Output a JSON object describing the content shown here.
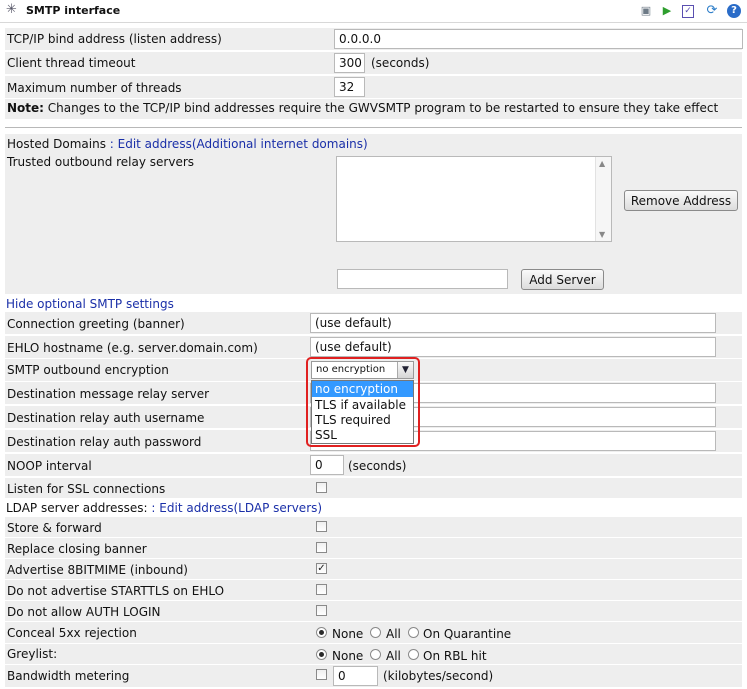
{
  "header": {
    "title": "SMTP interface"
  },
  "bind": {
    "label": "TCP/IP bind address (listen address)",
    "value": "0.0.0.0"
  },
  "client_timeout": {
    "label": "Client thread timeout",
    "value": "300",
    "unit": "(seconds)"
  },
  "max_threads": {
    "label": "Maximum number of threads",
    "value": "32"
  },
  "note": {
    "bold": "Note:",
    "text": " Changes to the TCP/IP bind addresses require the GWVSMTP program to be restarted to ensure they take effect"
  },
  "hosted_domains": {
    "label": "Hosted Domains",
    "sep": " : ",
    "link": "Edit address(Additional internet domains)"
  },
  "relay_servers": {
    "label": "Trusted outbound relay servers",
    "remove_button": "Remove Address",
    "add_button": "Add Server",
    "new_value": ""
  },
  "optional_link": "Hide optional SMTP settings",
  "greeting": {
    "label": "Connection greeting (banner)",
    "value": "(use default)"
  },
  "ehlo": {
    "label": "EHLO hostname (e.g. server.domain.com)",
    "value": "(use default)"
  },
  "encryption": {
    "label": "SMTP outbound encryption",
    "selected": "no encryption",
    "options": [
      "no encryption",
      "TLS if available",
      "TLS required",
      "SSL"
    ]
  },
  "dest_relay": {
    "label": "Destination message relay server",
    "value": ""
  },
  "dest_user": {
    "label": "Destination relay auth username",
    "value": ""
  },
  "dest_pass": {
    "label": "Destination relay auth password",
    "value": ""
  },
  "noop": {
    "label": "NOOP interval",
    "value": "0",
    "unit": "(seconds)"
  },
  "ssl_listen": {
    "label": "Listen for SSL connections",
    "checked": false
  },
  "ldap": {
    "label": "LDAP server addresses:",
    "sep": " : ",
    "link": "Edit address(LDAP servers)"
  },
  "store_forward": {
    "label": "Store & forward",
    "checked": false
  },
  "replace_banner": {
    "label": "Replace closing banner",
    "checked": false
  },
  "advertise_8bit": {
    "label": "Advertise 8BITMIME (inbound)",
    "checked": true
  },
  "no_starttls": {
    "label": "Do not advertise STARTTLS on EHLO",
    "checked": false
  },
  "no_auth_login": {
    "label": "Do not allow AUTH LOGIN",
    "checked": false
  },
  "conceal": {
    "label": "Conceal 5xx rejection",
    "options": [
      "None",
      "All",
      "On Quarantine"
    ],
    "selected": "None"
  },
  "greylist": {
    "label": "Greylist:",
    "options": [
      "None",
      "All",
      "On RBL hit"
    ],
    "selected": "None"
  },
  "bandwidth": {
    "label": "Bandwidth metering",
    "checked": false,
    "value": "0",
    "unit": "(kilobytes/second)"
  },
  "colors": {
    "link": "#1a2fa8",
    "row_bg": "#eeeeee",
    "highlight_red": "#e02020",
    "selected_blue": "#3399ff"
  }
}
